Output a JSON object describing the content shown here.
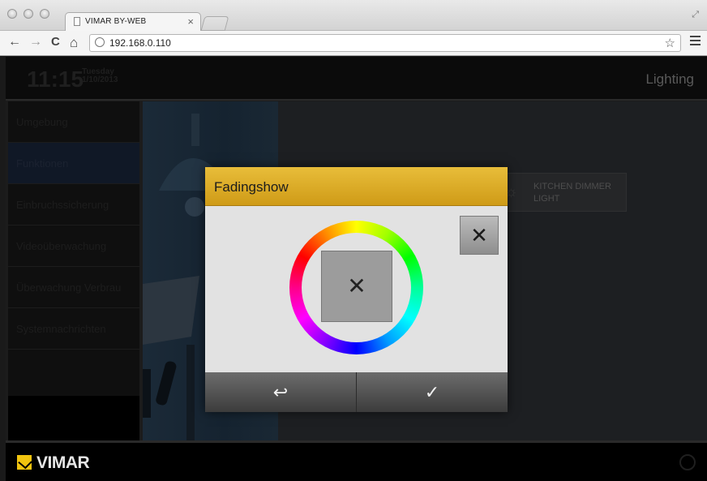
{
  "browser": {
    "tab_title": "VIMAR BY-WEB",
    "tab_close": "×",
    "url": "192.168.0.110",
    "back": "←",
    "forward": "→",
    "reload": "C",
    "home": "⌂",
    "star": "☆"
  },
  "header": {
    "time": "11:15",
    "weekday": "Tuesday",
    "date": "1/10/2013",
    "section": "Lighting"
  },
  "sidebar": {
    "items": [
      {
        "label": "Umgebung"
      },
      {
        "label": "Funktionen"
      },
      {
        "label": "Einbruchssicherung"
      },
      {
        "label": "Videoüberwachung"
      },
      {
        "label": "Überwachung Verbrau"
      },
      {
        "label": "Systemnachrichten"
      }
    ],
    "active_index": 1
  },
  "tile": {
    "line1": "KITCHEN DIMMER",
    "line2": "LIGHT",
    "icon": "bulb-icon"
  },
  "footer": {
    "brand": "VIMAR"
  },
  "dialog": {
    "title": "Fadingshow",
    "close_glyph": "✕",
    "swatch_glyph": "✕",
    "back_glyph": "↩",
    "confirm_glyph": "✓",
    "header_color": "#d9a723"
  }
}
